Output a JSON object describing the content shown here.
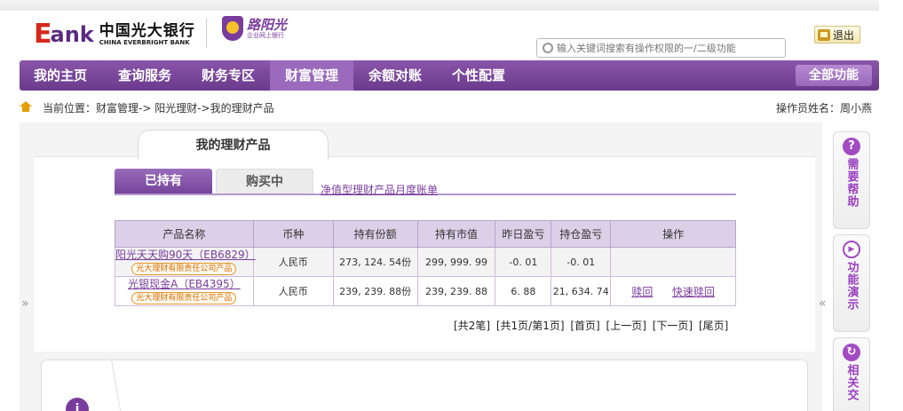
{
  "header": {
    "logo_e": "E",
    "logo_ank": "ank",
    "bank_name_cn": "中国光大银行",
    "bank_name_en": "CHINA EVERBRIGHT BANK",
    "sub_brand": "路阳光",
    "sub_brand_tag": "企业网上银行",
    "logout_label": "退出",
    "search_placeholder": "输入关键词搜索有操作权限的一/二级功能"
  },
  "nav": {
    "items": [
      {
        "label": "我的主页",
        "active": false
      },
      {
        "label": "查询服务",
        "active": false
      },
      {
        "label": "财务专区",
        "active": false
      },
      {
        "label": "财富管理",
        "active": true
      },
      {
        "label": "余额对账",
        "active": false
      },
      {
        "label": "个性配置",
        "active": false
      }
    ],
    "all_functions": "全部功能"
  },
  "breadcrumb": {
    "text": "当前位置：财富管理-> 阳光理财->我的理财产品",
    "operator": "操作员姓名：周小燕"
  },
  "page": {
    "title": "我的理财产品",
    "tab_held": "已持有",
    "tab_buying": "购买中",
    "monthly_statement": "净值型理财产品月度账单"
  },
  "table": {
    "headers": [
      "产品名称",
      "币种",
      "持有份额",
      "持有市值",
      "昨日盈亏",
      "持仓盈亏",
      "操作"
    ],
    "rows": [
      {
        "name": "阳光天天购90天（EB6829）",
        "tag": "光大理财有限责任公司产品",
        "currency": "人民币",
        "shares": "273, 124. 54份",
        "market_value": "299, 999. 99",
        "yesterday_pnl": "-0. 01",
        "position_pnl": "-0. 01",
        "actions": []
      },
      {
        "name": "光银现金A（EB4395）",
        "tag": "光大理财有限责任公司产品",
        "currency": "人民币",
        "shares": "239, 239. 88份",
        "market_value": "239, 239. 88",
        "yesterday_pnl": "6. 88",
        "position_pnl": "21, 634. 74",
        "actions": [
          "赎回",
          "快速赎回"
        ]
      }
    ]
  },
  "pager": {
    "total": "[共2笔]",
    "pages": "[共1页/第1页]",
    "first": "[首页]",
    "prev": "[上一页]",
    "next": "[下一页]",
    "last": "[尾页]"
  },
  "sidebar": {
    "help": "需要帮助",
    "demo": "功能演示",
    "related": "相关交"
  },
  "glyphs": {
    "left_arrow": "»",
    "right_arrow": "«",
    "help_glyph": "?",
    "demo_glyph": "▶",
    "related_glyph": "↻",
    "info_glyph": "i"
  }
}
